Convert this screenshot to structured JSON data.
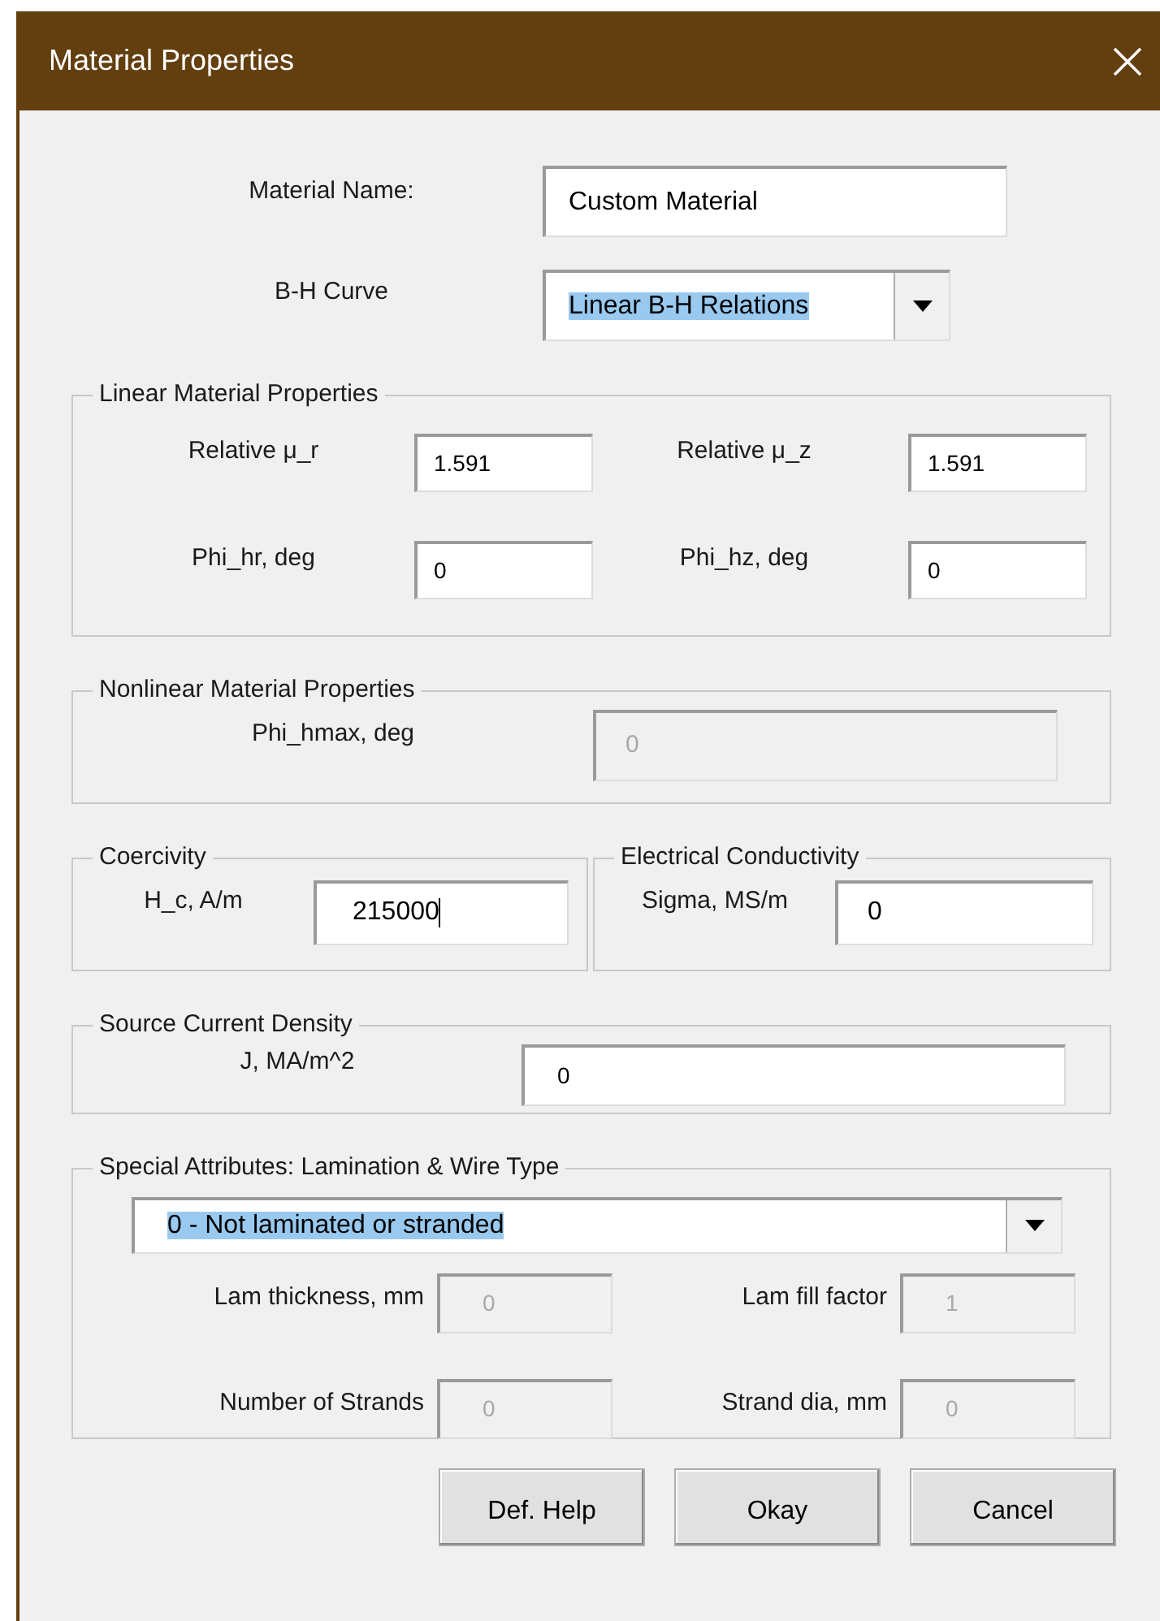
{
  "window": {
    "title": "Material Properties"
  },
  "material_name": {
    "label": "Material Name:",
    "value": "Custom Material"
  },
  "bh_curve": {
    "label": "B-H Curve",
    "value": "Linear B-H Relations",
    "highlighted": true
  },
  "linear": {
    "title": "Linear Material Properties",
    "fields": [
      {
        "label": "Relative μ_r",
        "value": "1.591",
        "disabled": false,
        "focused": false
      },
      {
        "label": "Relative μ_z",
        "value": "1.591",
        "disabled": false,
        "focused": false
      },
      {
        "label": "Phi_hr, deg",
        "value": "0",
        "disabled": false,
        "focused": false
      },
      {
        "label": "Phi_hz, deg",
        "value": "0",
        "disabled": false,
        "focused": false
      }
    ]
  },
  "nonlinear": {
    "title": "Nonlinear Material Properties",
    "fields": [
      {
        "label": "Phi_hmax, deg",
        "value": "0",
        "disabled": true,
        "focused": false
      }
    ]
  },
  "coercivity": {
    "title": "Coercivity",
    "fields": [
      {
        "label": "H_c, A/m",
        "value": "215000",
        "disabled": false,
        "focused": true
      }
    ]
  },
  "conductivity": {
    "title": "Electrical Conductivity",
    "fields": [
      {
        "label": "Sigma, MS/m",
        "value": "0",
        "disabled": false,
        "focused": false
      }
    ]
  },
  "source_current": {
    "title": "Source Current Density",
    "fields": [
      {
        "label": "J, MA/m^2",
        "value": "0",
        "disabled": false,
        "focused": false
      }
    ]
  },
  "special": {
    "title": "Special Attributes: Lamination & Wire Type",
    "dropdown": {
      "value": "0 - Not laminated or stranded",
      "highlighted": true
    },
    "fields": [
      {
        "label": "Lam thickness, mm",
        "value": "0",
        "disabled": true,
        "focused": false
      },
      {
        "label": "Lam fill factor",
        "value": "1",
        "disabled": true,
        "focused": false
      },
      {
        "label": "Number of Strands",
        "value": "0",
        "disabled": true,
        "focused": false
      },
      {
        "label": "Strand dia, mm",
        "value": "0",
        "disabled": true,
        "focused": false
      }
    ]
  },
  "buttons": [
    "Def. Help",
    "Okay",
    "Cancel"
  ]
}
